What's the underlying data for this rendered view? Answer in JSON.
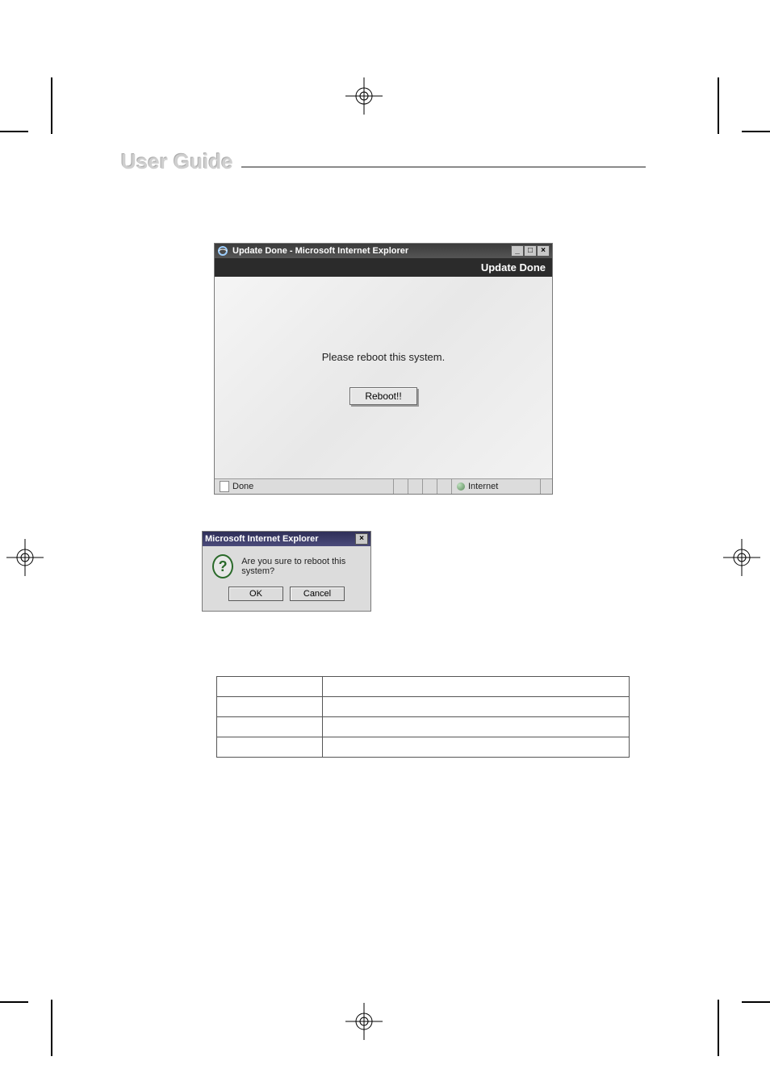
{
  "header": {
    "title": "User Guide"
  },
  "ie_window": {
    "title": "Update Done - Microsoft Internet Explorer",
    "banner": "Update Done",
    "message": "Please reboot this system.",
    "reboot_label": "Reboot!!",
    "status_done": "Done",
    "status_zone": "Internet"
  },
  "dialog": {
    "title": "Microsoft Internet Explorer",
    "message": "Are you sure to reboot this system?",
    "ok_label": "OK",
    "cancel_label": "Cancel"
  }
}
